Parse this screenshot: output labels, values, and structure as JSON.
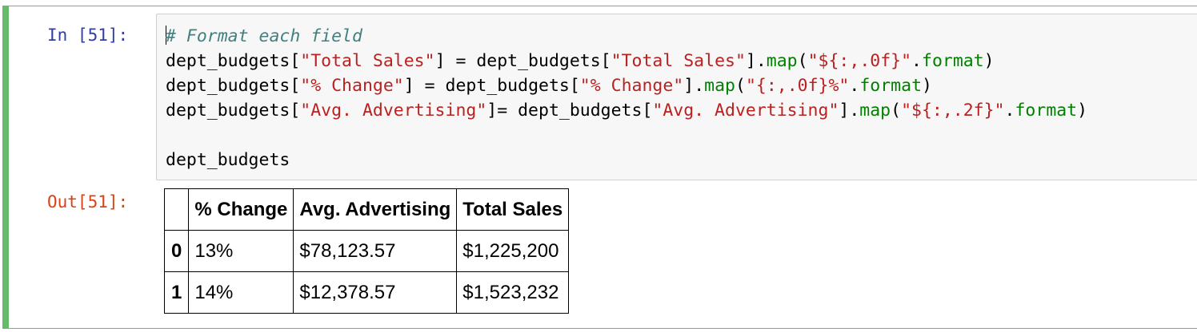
{
  "cell": {
    "in_prompt": "In [51]:",
    "out_prompt": "Out[51]:",
    "code_lines": [
      [
        {
          "t": "# Format each field",
          "c": "comment"
        }
      ],
      [
        {
          "t": "dept_budgets[",
          "c": "plain"
        },
        {
          "t": "\"Total Sales\"",
          "c": "string"
        },
        {
          "t": "] = dept_budgets[",
          "c": "plain"
        },
        {
          "t": "\"Total Sales\"",
          "c": "string"
        },
        {
          "t": "].",
          "c": "plain"
        },
        {
          "t": "map",
          "c": "attr"
        },
        {
          "t": "(",
          "c": "plain"
        },
        {
          "t": "\"${:,.0f}\"",
          "c": "string"
        },
        {
          "t": ".",
          "c": "plain"
        },
        {
          "t": "format",
          "c": "attr"
        },
        {
          "t": ")",
          "c": "plain"
        }
      ],
      [
        {
          "t": "dept_budgets[",
          "c": "plain"
        },
        {
          "t": "\"% Change\"",
          "c": "string"
        },
        {
          "t": "] = dept_budgets[",
          "c": "plain"
        },
        {
          "t": "\"% Change\"",
          "c": "string"
        },
        {
          "t": "].",
          "c": "plain"
        },
        {
          "t": "map",
          "c": "attr"
        },
        {
          "t": "(",
          "c": "plain"
        },
        {
          "t": "\"{:,.0f}%\"",
          "c": "string"
        },
        {
          "t": ".",
          "c": "plain"
        },
        {
          "t": "format",
          "c": "attr"
        },
        {
          "t": ")",
          "c": "plain"
        }
      ],
      [
        {
          "t": "dept_budgets[",
          "c": "plain"
        },
        {
          "t": "\"Avg. Advertising\"",
          "c": "string"
        },
        {
          "t": "]= dept_budgets[",
          "c": "plain"
        },
        {
          "t": "\"Avg. Advertising\"",
          "c": "string"
        },
        {
          "t": "].",
          "c": "plain"
        },
        {
          "t": "map",
          "c": "attr"
        },
        {
          "t": "(",
          "c": "plain"
        },
        {
          "t": "\"${:,.2f}\"",
          "c": "string"
        },
        {
          "t": ".",
          "c": "plain"
        },
        {
          "t": "format",
          "c": "attr"
        },
        {
          "t": ")",
          "c": "plain"
        }
      ],
      [],
      [
        {
          "t": "dept_budgets",
          "c": "plain"
        }
      ]
    ]
  },
  "output_table": {
    "columns": [
      "",
      "% Change",
      "Avg. Advertising",
      "Total Sales"
    ],
    "rows": [
      {
        "index": "0",
        "cells": [
          "13%",
          "$78,123.57",
          "$1,225,200"
        ]
      },
      {
        "index": "1",
        "cells": [
          "14%",
          "$12,378.57",
          "$1,523,232"
        ]
      }
    ]
  },
  "colors": {
    "cell_border_selected": "#66bb6a",
    "in_prompt": "#303f9f",
    "out_prompt": "#d84315",
    "code_background": "#f7f7f7",
    "comment": "#408080",
    "string": "#ba2121",
    "attribute": "#008000"
  }
}
